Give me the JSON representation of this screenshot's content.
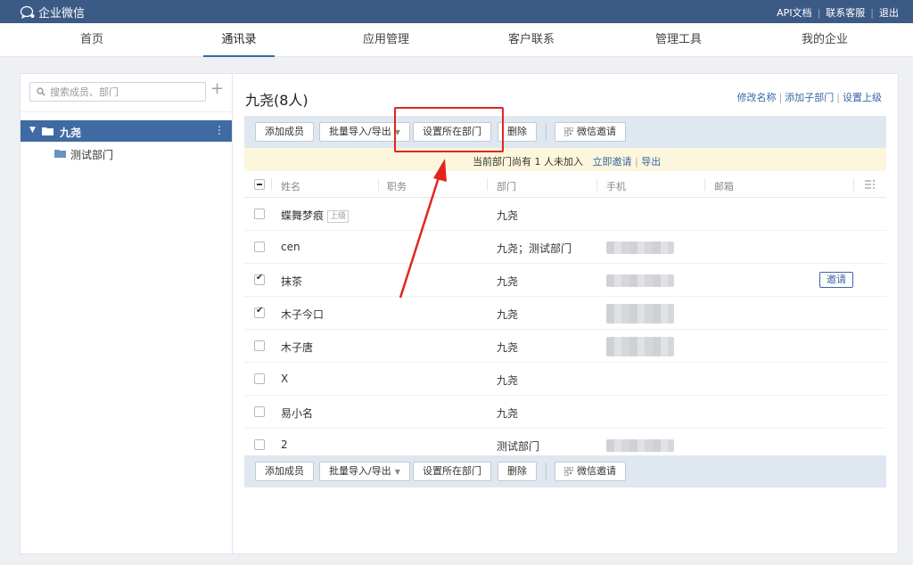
{
  "topbar": {
    "app_title": "企业微信",
    "links": [
      "API文档",
      "联系客服",
      "退出"
    ]
  },
  "nav": {
    "tabs": [
      "首页",
      "通讯录",
      "应用管理",
      "客户联系",
      "管理工具",
      "我的企业"
    ],
    "active": "通讯录"
  },
  "sidebar": {
    "search_placeholder": "搜索成员、部门",
    "tree": {
      "root_label": "九尧",
      "children": [
        "测试部门"
      ]
    }
  },
  "header": {
    "department_title": "九尧(8人)",
    "links": [
      "修改名称",
      "添加子部门",
      "设置上级"
    ]
  },
  "toolbar": {
    "add_member": "添加成员",
    "batch_import_export": "批量导入/导出",
    "set_department": "设置所在部门",
    "delete": "删除",
    "wechat_invite": "微信邀请"
  },
  "notice": {
    "text": "当前部门尚有 1 人未加入",
    "invite_now": "立即邀请",
    "export": "导出"
  },
  "table": {
    "columns": [
      "姓名",
      "职务",
      "部门",
      "手机",
      "邮箱"
    ],
    "rows": [
      {
        "name": "蝶舞梦痕",
        "tag": "上级",
        "dept": "九尧",
        "checked": false,
        "phone_blurred": false,
        "invite": ""
      },
      {
        "name": "cen",
        "tag": "",
        "dept": "九尧；测试部门",
        "checked": false,
        "phone_blurred": true,
        "invite": ""
      },
      {
        "name": "抹茶",
        "tag": "",
        "dept": "九尧",
        "checked": true,
        "phone_blurred": true,
        "invite": "邀请"
      },
      {
        "name": "木子今口",
        "tag": "",
        "dept": "九尧",
        "checked": true,
        "phone_blurred": true,
        "invite": ""
      },
      {
        "name": "木子唐",
        "tag": "",
        "dept": "九尧",
        "checked": false,
        "phone_blurred": true,
        "invite": ""
      },
      {
        "name": "X",
        "tag": "",
        "dept": "九尧",
        "checked": false,
        "phone_blurred": false,
        "invite": ""
      },
      {
        "name": "易小名",
        "tag": "",
        "dept": "九尧",
        "checked": false,
        "phone_blurred": false,
        "invite": ""
      },
      {
        "name": "2",
        "tag": "",
        "dept": "测试部门",
        "checked": false,
        "phone_blurred": true,
        "invite": ""
      }
    ]
  },
  "colors": {
    "topbar_bg": "#3c5a86",
    "accent_blue": "#3f6aa3",
    "toolbar_bg": "#dfe7f1",
    "notice_bg": "#fcf7dc",
    "annotation_red": "#e2251f"
  }
}
